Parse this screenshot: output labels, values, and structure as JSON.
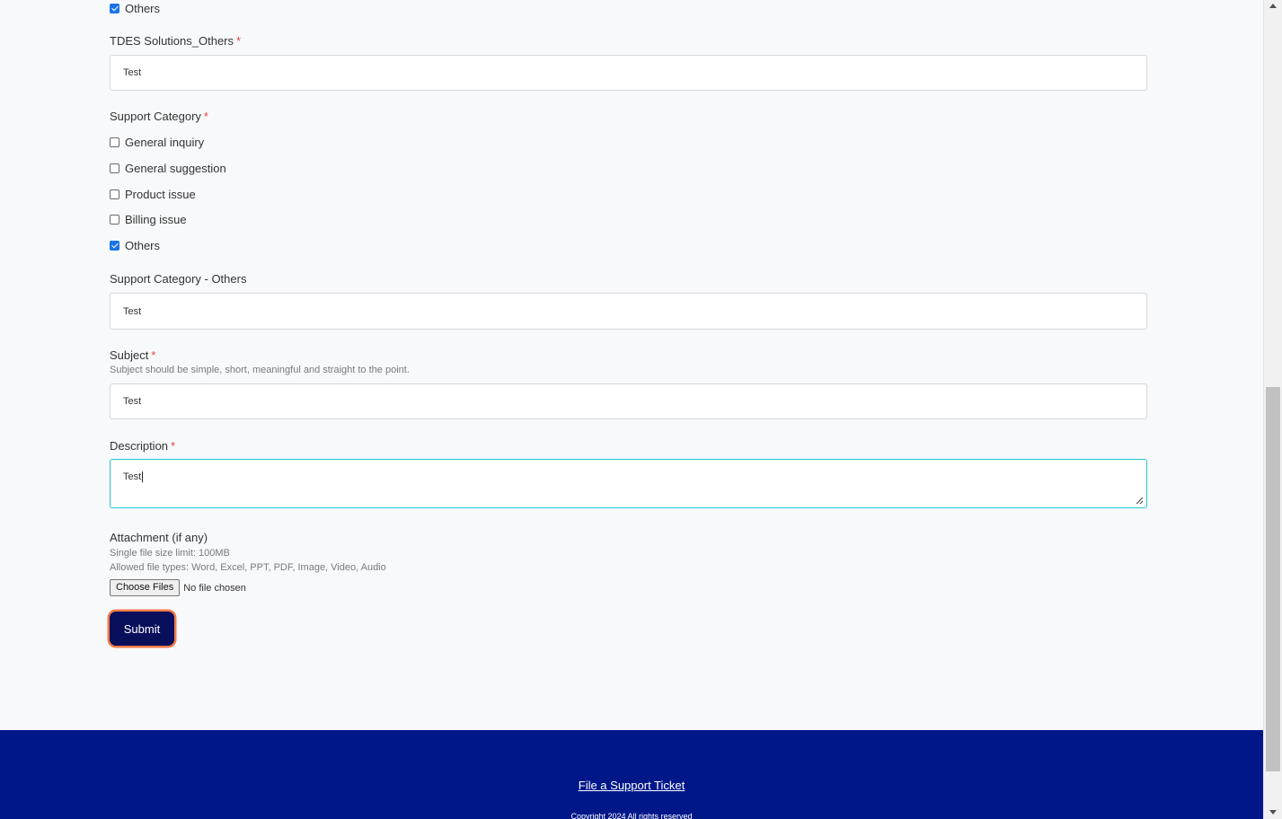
{
  "tdes_solutions": {
    "others_option": {
      "label": "Others",
      "checked": true
    },
    "others_field": {
      "label": "TDES Solutions_Others",
      "required_mark": "*",
      "value": "Test"
    }
  },
  "support_category": {
    "label": "Support Category",
    "required_mark": "*",
    "options": [
      {
        "label": "General inquiry",
        "checked": false
      },
      {
        "label": "General suggestion",
        "checked": false
      },
      {
        "label": "Product issue",
        "checked": false
      },
      {
        "label": "Billing issue",
        "checked": false
      },
      {
        "label": "Others",
        "checked": true
      }
    ],
    "others_field": {
      "label": "Support Category - Others",
      "value": "Test"
    }
  },
  "subject": {
    "label": "Subject",
    "required_mark": "*",
    "hint": "Subject should be simple, short, meaningful and straight to the point.",
    "value": "Test"
  },
  "description": {
    "label": "Description",
    "required_mark": "*",
    "value": "Test"
  },
  "attachment": {
    "label": "Attachment (if any)",
    "hint_size": "Single file size limit: 100MB",
    "hint_types": "Allowed file types: Word, Excel, PPT, PDF, Image, Video, Audio",
    "button_label": "Choose Files",
    "status": "No file chosen"
  },
  "submit_label": "Submit",
  "footer": {
    "link_label": "File a Support Ticket",
    "copyright": "Copyright 2024 All rights reserved"
  },
  "colors": {
    "accent_navy": "#0a0f5c",
    "footer_blue": "#00178a",
    "focus_cyan": "#28c7d2",
    "submit_outline": "#f07c4a",
    "required_red": "#e0463c"
  }
}
